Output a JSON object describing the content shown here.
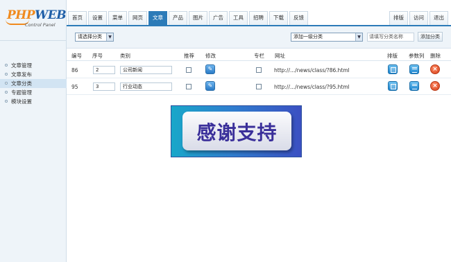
{
  "logo": {
    "brand_php": "PHP",
    "brand_web": "WEB",
    "subtitle": "Control Panel"
  },
  "sidebar": {
    "items": [
      {
        "label": "文章管理",
        "active": false
      },
      {
        "label": "文章发布",
        "active": false
      },
      {
        "label": "文章分类",
        "active": true
      },
      {
        "label": "专题管理",
        "active": false
      },
      {
        "label": "模块设置",
        "active": false
      }
    ]
  },
  "tabs": {
    "main": [
      "首页",
      "设置",
      "菜单",
      "网页",
      "文章",
      "产品",
      "图片",
      "广告",
      "工具",
      "招聘",
      "下载",
      "反馈"
    ],
    "active": "文章",
    "right": [
      "排版",
      "访问",
      "退出"
    ]
  },
  "toolbar": {
    "category_select": "请选择分类",
    "parent_select": "添加一级分类",
    "name_placeholder": "请填写分类名称",
    "add_button": "添加分类"
  },
  "table": {
    "headers": {
      "id": "编号",
      "order": "序号",
      "category": "类别",
      "recommend": "推荐",
      "edit": "修改",
      "column": "专栏",
      "url": "网址",
      "layout": "排版",
      "params": "参数列",
      "delete": "删除"
    },
    "rows": [
      {
        "id": "86",
        "order": "2",
        "name": "公司新闻",
        "url": "http://.../news/class/?86.html"
      },
      {
        "id": "95",
        "order": "3",
        "name": "行业动态",
        "url": "http://.../news/class/?95.html"
      }
    ]
  },
  "banner": {
    "text": "感谢支持"
  },
  "colors": {
    "accent": "#2c7bb8",
    "sidebar_bg": "#eef4f9",
    "delete_icon": "#d5401b",
    "banner_text": "#3a2f9a"
  }
}
